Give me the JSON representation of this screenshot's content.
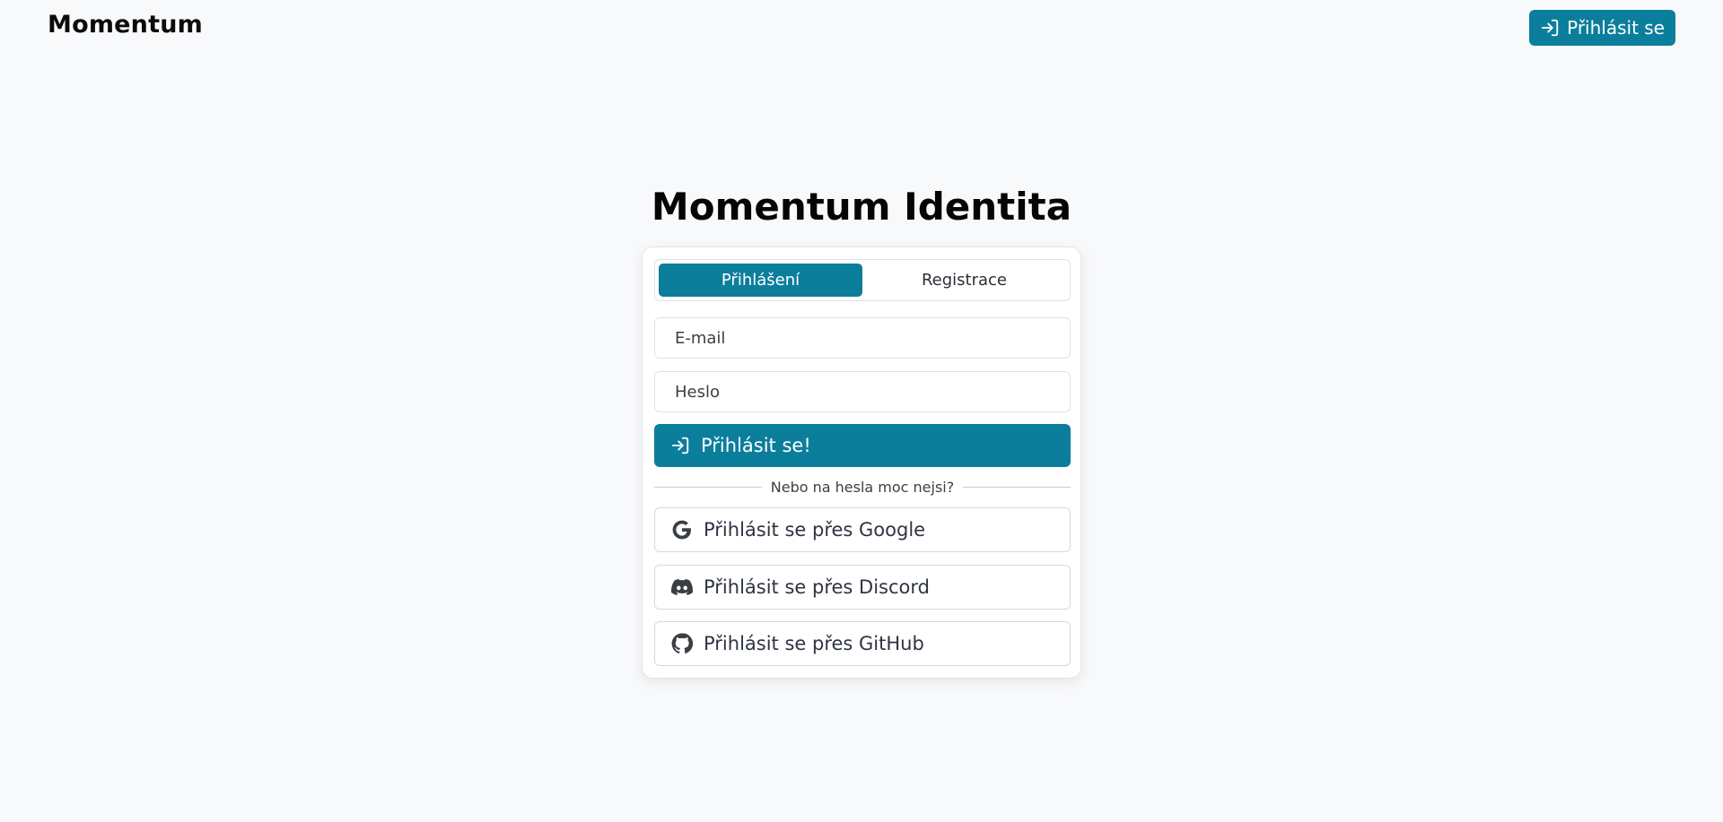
{
  "header": {
    "brand": "Momentum",
    "login_button_label": "Přihlásit se"
  },
  "main": {
    "title": "Momentum Identita",
    "tabs": [
      {
        "label": "Přihlášení",
        "active": true
      },
      {
        "label": "Registrace",
        "active": false
      }
    ],
    "email_placeholder": "E-mail",
    "password_placeholder": "Heslo",
    "submit_label": "Přihlásit se!",
    "divider_text": "Nebo na hesla moc nejsi?",
    "social": [
      {
        "label": "Přihlásit se přes Google",
        "icon": "google-icon"
      },
      {
        "label": "Přihlásit se přes Discord",
        "icon": "discord-icon"
      },
      {
        "label": "Přihlásit se přes GitHub",
        "icon": "github-icon"
      }
    ]
  },
  "colors": {
    "accent": "#0b7e9c",
    "background": "#f8f9fb"
  }
}
